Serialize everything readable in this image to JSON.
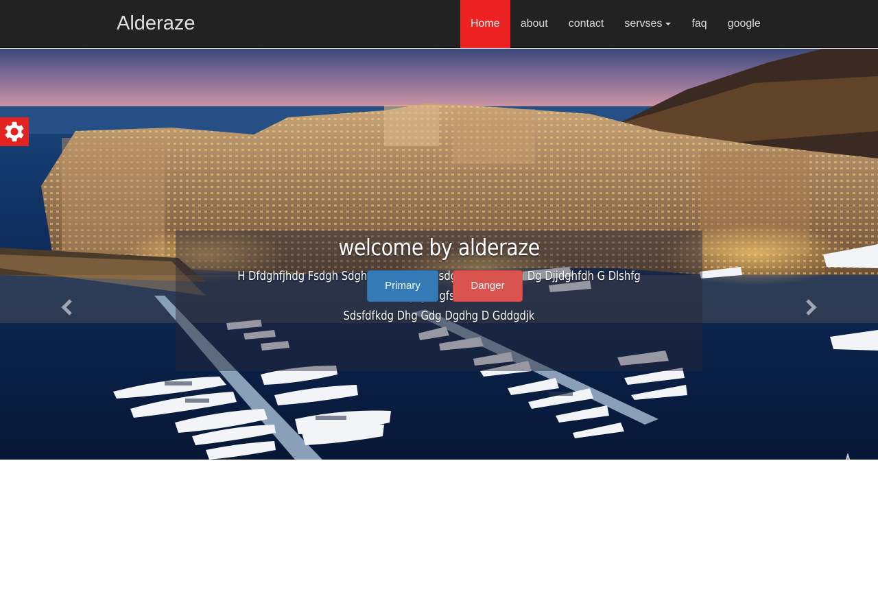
{
  "navbar": {
    "brand": "Alderaze",
    "items": [
      {
        "label": "Home",
        "active": true
      },
      {
        "label": "about"
      },
      {
        "label": "contact"
      },
      {
        "label": "servses",
        "dropdown": true
      },
      {
        "label": "faq"
      },
      {
        "label": "google"
      }
    ]
  },
  "hero": {
    "title": "welcome by alderaze",
    "text_line1": "H Dfdghfjhdg Fsdgh Sdgh Fsdghfhsdgfhsdgfsdgh Ghdsfh Dg Djjdghfdh G Dlshfg Jhghdgfsdh",
    "text_line2": "Sdsfdfkdg Dhg Gdg Dgdhg D Gddgdjk",
    "primary_button": "Primary",
    "danger_button": "Danger",
    "slides_total": 4,
    "active_slide": 1
  },
  "colors": {
    "navbar_bg": "#222222",
    "active_nav": "#ee2222",
    "primary": "#337ab7",
    "danger": "#d9534f",
    "gear_bg": "#e32222"
  },
  "icons": {
    "settings": "gear-icon",
    "prev": "chevron-left-icon",
    "next": "chevron-right-icon",
    "badge": "compass-badge-icon"
  }
}
